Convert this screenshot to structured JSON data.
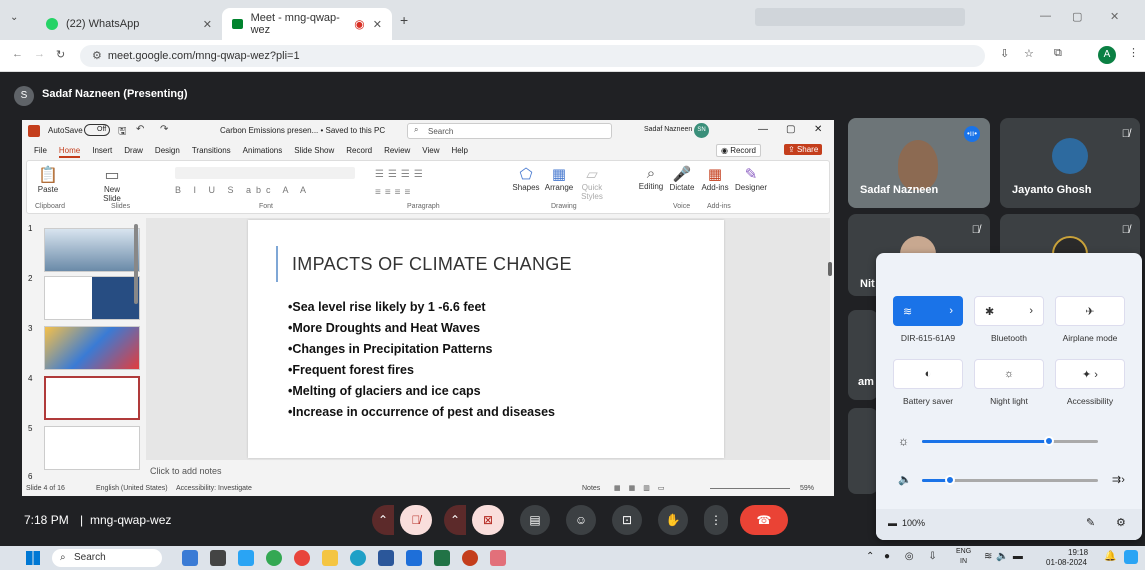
{
  "browser": {
    "tabs": [
      {
        "title": "(22) WhatsApp"
      },
      {
        "title": "Meet - mng-qwap-wez"
      }
    ],
    "url": "meet.google.com/mng-qwap-wez?pli=1",
    "avatar": "A"
  },
  "meet": {
    "presenter_banner": "Sadaf Nazneen (Presenting)",
    "presenter_initial": "S",
    "participants": [
      {
        "name": "Sadaf Nazneen"
      },
      {
        "name": "Jayanto Ghosh"
      },
      {
        "name": "Nit"
      },
      {
        "name": "am"
      }
    ],
    "time": "7:18 PM",
    "separator": "|",
    "meeting_code": "mng-qwap-wez"
  },
  "ppt": {
    "autosave_label": "AutoSave",
    "autosave_state": "Off",
    "doc_title": "Carbon Emissions presen... • Saved to this PC",
    "search_placeholder": "Search",
    "user": "Sadaf Nazneen",
    "user_initials": "SN",
    "menu": [
      "File",
      "Home",
      "Insert",
      "Draw",
      "Design",
      "Transitions",
      "Animations",
      "Slide Show",
      "Record",
      "Review",
      "View",
      "Help"
    ],
    "record_label": "Record",
    "share_label": "Share",
    "ribbon": [
      {
        "label": "Paste"
      },
      {
        "label": "New Slide"
      },
      {
        "label": "Shapes"
      },
      {
        "label": "Arrange"
      },
      {
        "label": "Quick Styles"
      },
      {
        "label": "Editing"
      },
      {
        "label": "Dictate"
      },
      {
        "label": "Add-ins"
      },
      {
        "label": "Designer"
      }
    ],
    "groups": [
      "Clipboard",
      "Slides",
      "Font",
      "Paragraph",
      "Drawing",
      "Voice",
      "Add-ins"
    ],
    "thumb_numbers": [
      "1",
      "2",
      "3",
      "4",
      "5",
      "6"
    ],
    "slide": {
      "title": "IMPACTS OF CLIMATE CHANGE",
      "bullets": [
        "•Sea level rise likely by 1 -6.6 feet",
        "•More Droughts and Heat Waves",
        "•Changes in Precipitation Patterns",
        "•Frequent forest fires",
        "•Melting of glaciers and ice caps",
        "•Increase in occurrence of pest and diseases"
      ]
    },
    "notes": "Click to add notes",
    "status": {
      "slide": "Slide 4 of 16",
      "lang": "English (United States)",
      "access": "Accessibility: Investigate",
      "notes": "Notes",
      "zoom": "59%"
    }
  },
  "quick_settings": {
    "tiles": [
      {
        "label": "DIR-615-61A9"
      },
      {
        "label": "Bluetooth"
      },
      {
        "label": "Airplane mode"
      },
      {
        "label": "Battery saver"
      },
      {
        "label": "Night light"
      },
      {
        "label": "Accessibility"
      }
    ],
    "brightness": 0.72,
    "volume": 0.16,
    "battery": "100%"
  },
  "taskbar": {
    "search": "Search",
    "lang_top": "ENG",
    "lang_bottom": "IN",
    "time": "19:18",
    "date": "01-08-2024"
  }
}
